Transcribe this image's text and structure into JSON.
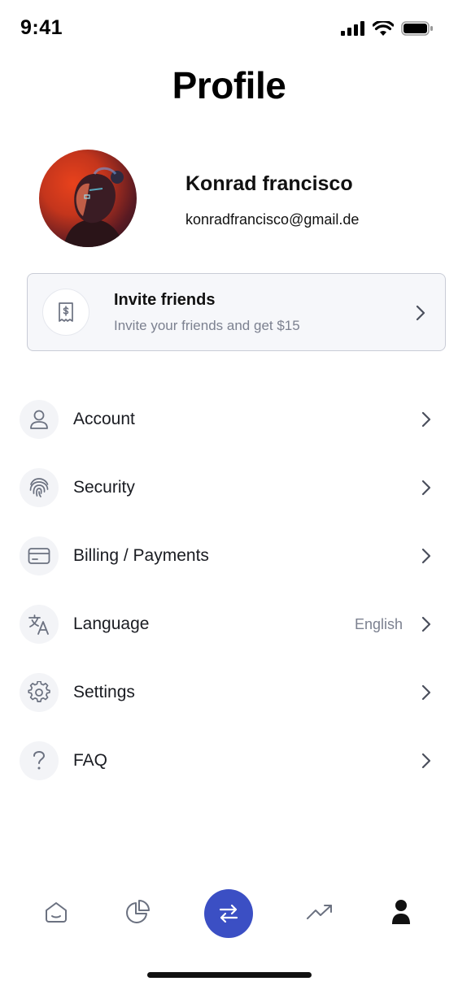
{
  "status_bar": {
    "time": "9:41"
  },
  "page": {
    "title": "Profile"
  },
  "user": {
    "name": "Konrad francisco",
    "email": "konradfrancisco@gmail.de"
  },
  "invite": {
    "title": "Invite friends",
    "subtitle": "Invite your friends and get $15",
    "icon": "receipt-dollar-icon"
  },
  "menu": [
    {
      "label": "Account",
      "icon": "user-icon",
      "value": ""
    },
    {
      "label": "Security",
      "icon": "fingerprint-icon",
      "value": ""
    },
    {
      "label": "Billing / Payments",
      "icon": "credit-card-icon",
      "value": ""
    },
    {
      "label": "Language",
      "icon": "translate-icon",
      "value": "English"
    },
    {
      "label": "Settings",
      "icon": "gear-icon",
      "value": ""
    },
    {
      "label": "FAQ",
      "icon": "question-icon",
      "value": ""
    }
  ],
  "bottom_nav": [
    {
      "icon": "home-icon",
      "active": false
    },
    {
      "icon": "pie-chart-icon",
      "active": false
    },
    {
      "icon": "transfer-icon",
      "active": false,
      "primary": true
    },
    {
      "icon": "trending-up-icon",
      "active": false
    },
    {
      "icon": "profile-icon",
      "active": true
    }
  ],
  "colors": {
    "accent": "#3b4fc4",
    "muted_text": "#7c8190",
    "card_border": "#c9ccd6",
    "card_bg": "#f6f7fa"
  }
}
